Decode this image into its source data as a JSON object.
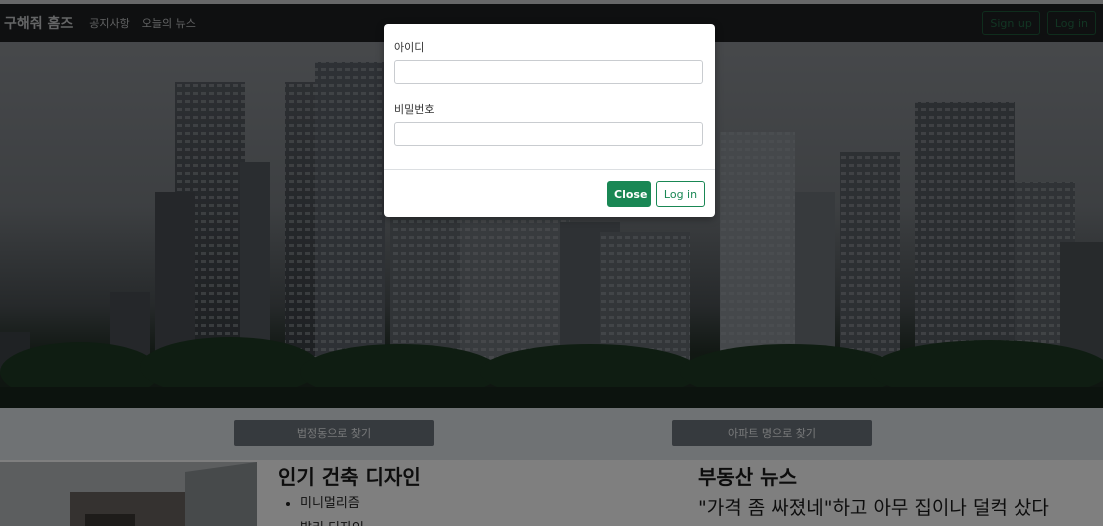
{
  "navbar": {
    "brand": "구해줘 홈즈",
    "links": [
      "공지사항",
      "오늘의 뉴스"
    ],
    "signup_label": "Sign up",
    "login_label": "Log in"
  },
  "search": {
    "by_district_label": "법정동으로 찾기",
    "by_apartment_label": "아파트 명으로 찾기"
  },
  "design": {
    "title": "인기 건축 디자인",
    "items": [
      "미니멀리즘",
      "발리 디자인"
    ]
  },
  "news": {
    "title": "부동산 뉴스",
    "headline": "\"가격 좀 싸졌네\"하고 아무 집이나 덜컥 샀다"
  },
  "login_modal": {
    "id_label": "아이디",
    "id_value": "",
    "password_label": "비밀번호",
    "password_value": "",
    "close_label": "Close",
    "login_label": "Log in"
  },
  "colors": {
    "navbar_bg": "#1f2123",
    "accent_green": "#198754",
    "search_button": "#6c757d"
  }
}
